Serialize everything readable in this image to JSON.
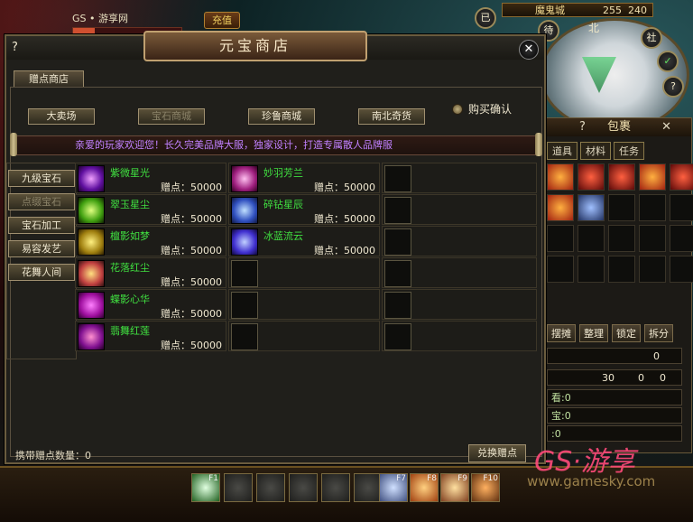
{
  "topbar": {
    "site": "GS • 游享网",
    "recharge": "充值"
  },
  "map": {
    "name": "魔鬼城",
    "x": "255",
    "y": "240",
    "north": "北",
    "badge": "已"
  },
  "minimap_buttons": {
    "待": "待",
    "社": "社"
  },
  "bag": {
    "title": "包裹",
    "help": "?",
    "close": "✕",
    "tabs": [
      "道具",
      "材料",
      "任务"
    ],
    "buttons": [
      "摆摊",
      "整理",
      "锁定",
      "拆分"
    ],
    "rows": [
      "0",
      "30",
      "0",
      "0",
      "看:0",
      "宝:0",
      ":0"
    ]
  },
  "shop": {
    "title": "元宝商店",
    "help": "?",
    "close": "✕",
    "tab": "赠点商店",
    "categories": [
      "大卖场",
      "宝石商城",
      "珍鲁商城",
      "南北奇货"
    ],
    "confirm": "购买确认",
    "banner": "亲爱的玩家欢迎您！长久完美品牌大服，独家设计，打造专属散人品牌服",
    "side": [
      "九级宝石",
      "点缀宝石",
      "宝石加工",
      "易容发艺",
      "花舞人间"
    ],
    "items": [
      {
        "name": "紫微星光",
        "price": "赠点：50000"
      },
      {
        "name": "妙羽芳兰",
        "price": "赠点：50000"
      },
      {
        "name": "翠玉星尘",
        "price": "赠点：50000"
      },
      {
        "name": "碎钻星辰",
        "price": "赠点：50000"
      },
      {
        "name": "檀影如梦",
        "price": "赠点：50000"
      },
      {
        "name": "冰蓝流云",
        "price": "赠点：50000"
      },
      {
        "name": "花落红尘",
        "price": "赠点：50000"
      },
      {
        "name": "蝶影心华",
        "price": "赠点：50000"
      },
      {
        "name": "翡舞红莲",
        "price": "赠点：50000"
      }
    ],
    "points": "携带赠点数量：0",
    "exchange": "兑换赠点"
  },
  "hotbar": {
    "keys": [
      "F1",
      "F7",
      "F8",
      "F9",
      "F10"
    ]
  },
  "watermark": {
    "logo": "GS·游享",
    "url": "www.gamesky.com"
  }
}
